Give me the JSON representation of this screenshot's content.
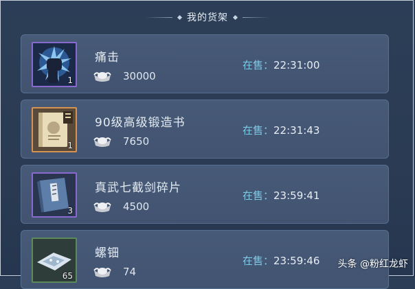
{
  "header": {
    "title": "我的货架"
  },
  "items": [
    {
      "name": "痛击",
      "qty": "1",
      "price": "30000",
      "status_label": "在售：",
      "time": "22:31:00",
      "icon": "fist-skill-icon"
    },
    {
      "name": "90级高级锻造书",
      "qty": "1",
      "price": "7650",
      "status_label": "在售：",
      "time": "22:31:43",
      "icon": "scroll-book-icon"
    },
    {
      "name": "真武七截剑碎片",
      "qty": "3",
      "price": "4500",
      "status_label": "在售：",
      "time": "23:59:41",
      "icon": "book-fragment-icon"
    },
    {
      "name": "螺钿",
      "qty": "65",
      "price": "74",
      "status_label": "在售：",
      "time": "23:59:46",
      "icon": "shell-material-icon"
    }
  ],
  "currency_icon": "silver-ingot-icon",
  "watermark": "头条 @粉红龙虾",
  "colors": {
    "status_label": "#7ec9e6",
    "card_bg": "#475a77",
    "rare_border": "#8a6ad0",
    "epic_border": "#d69352",
    "common_border": "#5c8a5a"
  }
}
